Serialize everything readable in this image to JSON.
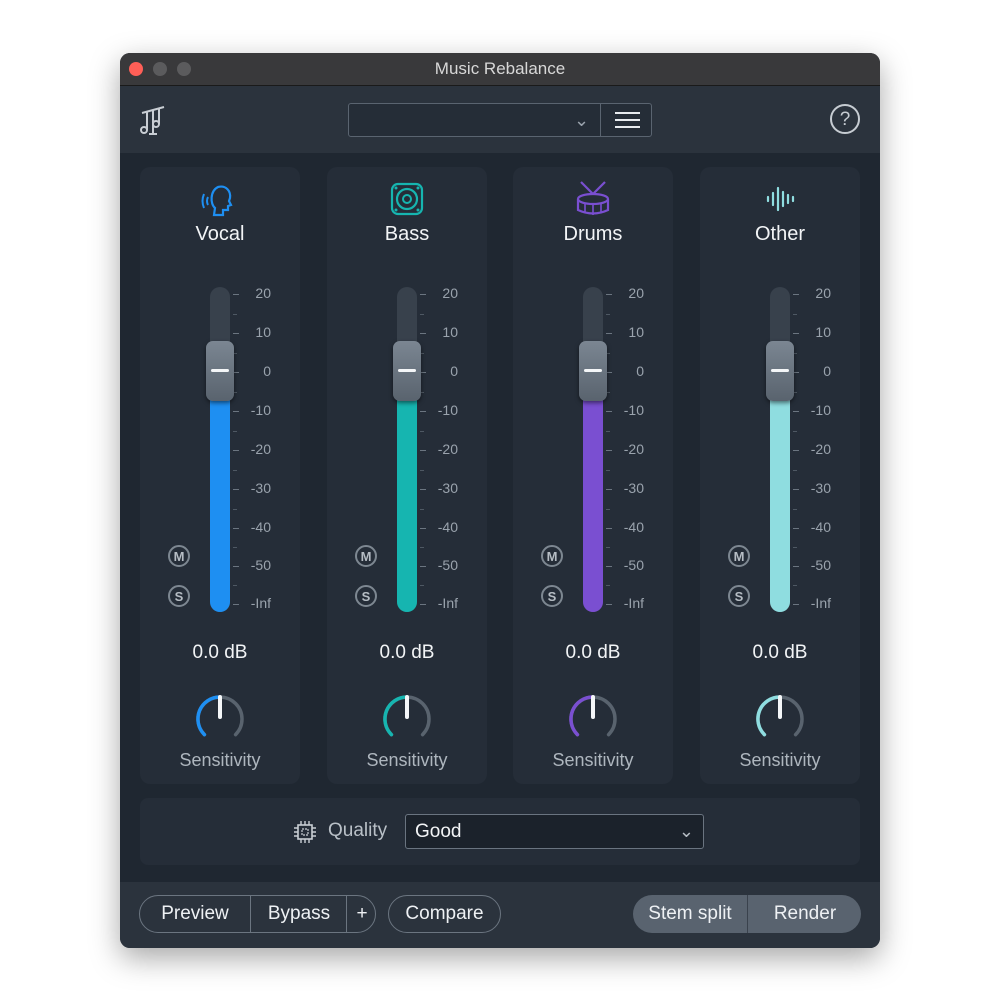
{
  "window": {
    "title": "Music Rebalance"
  },
  "header": {
    "preset_value": "",
    "logo_icon": "music-rebalance-logo-icon",
    "menu_icon": "hamburger-menu-icon",
    "help_label": "?"
  },
  "stems": [
    {
      "name": "Vocal",
      "icon": "vocal-head-icon",
      "color": "#1e8ff2",
      "value": "0.0 dB",
      "sensitivity_label": "Sensitivity"
    },
    {
      "name": "Bass",
      "icon": "speaker-icon",
      "color": "#16b5b0",
      "value": "0.0 dB",
      "sensitivity_label": "Sensitivity"
    },
    {
      "name": "Drums",
      "icon": "drum-icon",
      "color": "#7a4fd1",
      "value": "0.0 dB",
      "sensitivity_label": "Sensitivity"
    },
    {
      "name": "Other",
      "icon": "waveform-icon",
      "color": "#8fdde0",
      "value": "0.0 dB",
      "sensitivity_label": "Sensitivity"
    }
  ],
  "scale": [
    "20",
    "10",
    "0",
    "-10",
    "-20",
    "-30",
    "-40",
    "-50",
    "-Inf"
  ],
  "buttons": {
    "mute": "M",
    "solo": "S"
  },
  "quality": {
    "label": "Quality",
    "value": "Good",
    "icon": "processor-chip-icon"
  },
  "footer": {
    "preview": "Preview",
    "bypass": "Bypass",
    "plus": "+",
    "compare": "Compare",
    "stem_split": "Stem split",
    "render": "Render"
  }
}
